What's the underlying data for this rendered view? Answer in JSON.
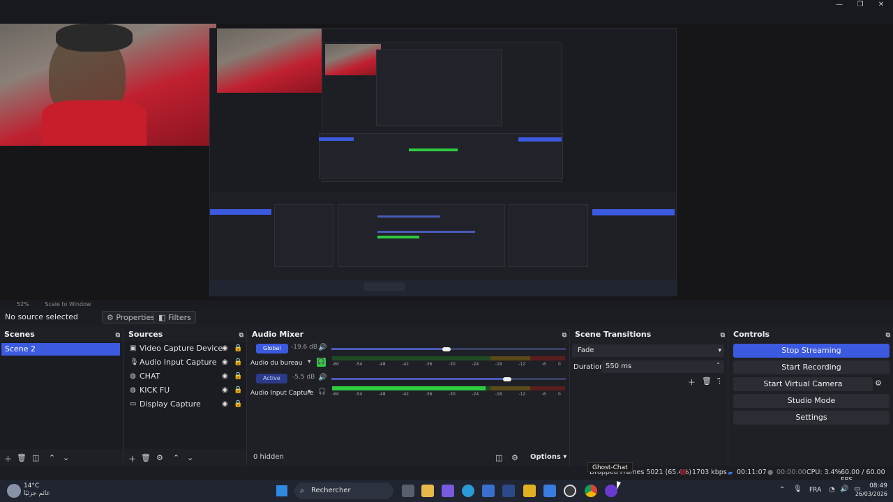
{
  "window": {
    "controls": [
      "—",
      "❐",
      "✕"
    ]
  },
  "preview": {
    "zoom": "52%",
    "scale_mode": "Scale to Window"
  },
  "source_toolbar": {
    "selection": "No source selected",
    "properties_label": "Properties",
    "filters_label": "Filters"
  },
  "scenes": {
    "title": "Scenes",
    "items": [
      "Scene 2"
    ]
  },
  "sources": {
    "title": "Sources",
    "items": [
      {
        "name": "Video Capture Device",
        "icon": "camera-icon"
      },
      {
        "name": "Audio Input Capture",
        "icon": "microphone-icon"
      },
      {
        "name": "CHAT",
        "icon": "globe-icon"
      },
      {
        "name": "KICK FU",
        "icon": "globe-icon"
      },
      {
        "name": "Display Capture",
        "icon": "monitor-icon"
      }
    ]
  },
  "audio_mixer": {
    "title": "Audio Mixer",
    "channels": [
      {
        "badge": "Global",
        "db": "-19.6 dB",
        "name": "Audio du bureau",
        "volume_fraction": 0.49,
        "level_fraction": 0.0
      },
      {
        "badge": "Active",
        "db": "-5.5 dB",
        "name": "Audio Input Capture",
        "volume_fraction": 0.75,
        "level_fraction": 0.66
      }
    ],
    "ticks": [
      "-60",
      "-54",
      "-48",
      "-42",
      "-36",
      "-30",
      "-24",
      "-18",
      "-12",
      "-6",
      "0"
    ],
    "hidden_label": "0 hidden",
    "options_label": "Options"
  },
  "scene_transitions": {
    "title": "Scene Transitions",
    "transition": "Fade",
    "duration_label": "Duration",
    "duration_value": "550 ms"
  },
  "controls": {
    "title": "Controls",
    "stop_streaming": "Stop Streaming",
    "start_recording": "Start Recording",
    "start_virtual_camera": "Start Virtual Camera",
    "studio_mode": "Studio Mode",
    "settings": "Settings"
  },
  "tooltip": "Ghost-Chat",
  "status": {
    "dropped_frames": "Dropped Frames 5021 (65.4%)",
    "bitrate": "1703 kbps",
    "stream_time": "00:11:07",
    "record_time": "00:00:00",
    "cpu": "CPU: 3.4%",
    "fps": "60.00 / 60.00 FPS"
  },
  "taskbar": {
    "weather_temp": "14°C",
    "weather_desc": "غائم جزئيًا",
    "search_label": "Rechercher",
    "language": "FRA",
    "time": "08:49",
    "date": "26/03/2026"
  },
  "colors": {
    "accent": "#3c5adf",
    "meter_green": "#2ecc40",
    "meter_yellow": "#c9a227",
    "meter_red": "#c0392b"
  }
}
